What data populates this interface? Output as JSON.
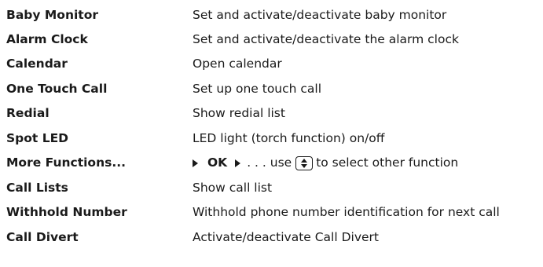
{
  "rows": [
    {
      "function": "Baby Monitor",
      "description": "Set and activate/deactivate baby monitor"
    },
    {
      "function": "Alarm Clock",
      "description": "Set and activate/deactivate the alarm clock"
    },
    {
      "function": "Calendar",
      "description": "Open calendar"
    },
    {
      "function": "One Touch Call",
      "description": "Set up one touch call"
    },
    {
      "function": "Redial",
      "description": "Show redial list"
    },
    {
      "function": "Spot LED",
      "description": "LED light (torch function) on/off"
    },
    {
      "function": "More Functions...",
      "description_parts": {
        "ok": "OK",
        "ellipsis_use": ". . . use",
        "rest": "to select other function"
      }
    },
    {
      "function": "Call Lists",
      "description": "Show call list"
    },
    {
      "function": "Withhold Number",
      "description": "Withhold phone number identification for next call"
    },
    {
      "function": "Call Divert",
      "description": "Activate/deactivate Call Divert"
    }
  ],
  "icons": {
    "step_arrow": "right-triangle-icon",
    "nav_key": "navigation-key-up-down-icon"
  }
}
